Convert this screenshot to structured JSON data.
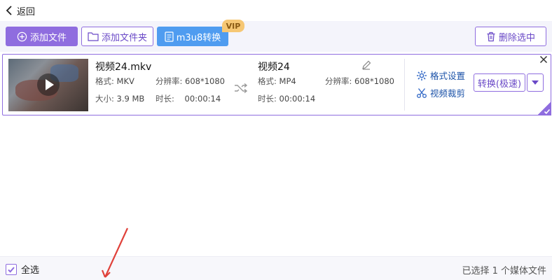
{
  "nav": {
    "back_label": "返回"
  },
  "toolbar": {
    "add_file": "添加文件",
    "add_folder": "添加文件夹",
    "m3u8": "m3u8转换",
    "vip_badge": "VIP",
    "delete_selected": "删除选中"
  },
  "file": {
    "source": {
      "name": "视频24.mkv",
      "format_label": "格式:",
      "format": "MKV",
      "resolution_label": "分辨率:",
      "resolution": "608*1080",
      "size_label": "大小:",
      "size": "3.9 MB",
      "duration_label": "时长:",
      "duration": "00:00:14"
    },
    "output": {
      "name": "视频24",
      "format_label": "格式:",
      "format": "MP4",
      "resolution_label": "分辨率:",
      "resolution": "608*1080",
      "duration_label": "时长:",
      "duration": "00:00:14"
    },
    "actions": {
      "format_settings": "格式设置",
      "video_crop": "视频裁剪",
      "convert": "转换(极速)"
    }
  },
  "footer": {
    "select_all": "全选",
    "status": "已选择 1 个媒体文件"
  },
  "colors": {
    "accent": "#8f6ddf",
    "blue": "#4f9cf0",
    "vip": "#f6c774",
    "annotation_arrow": "#e0413a"
  }
}
